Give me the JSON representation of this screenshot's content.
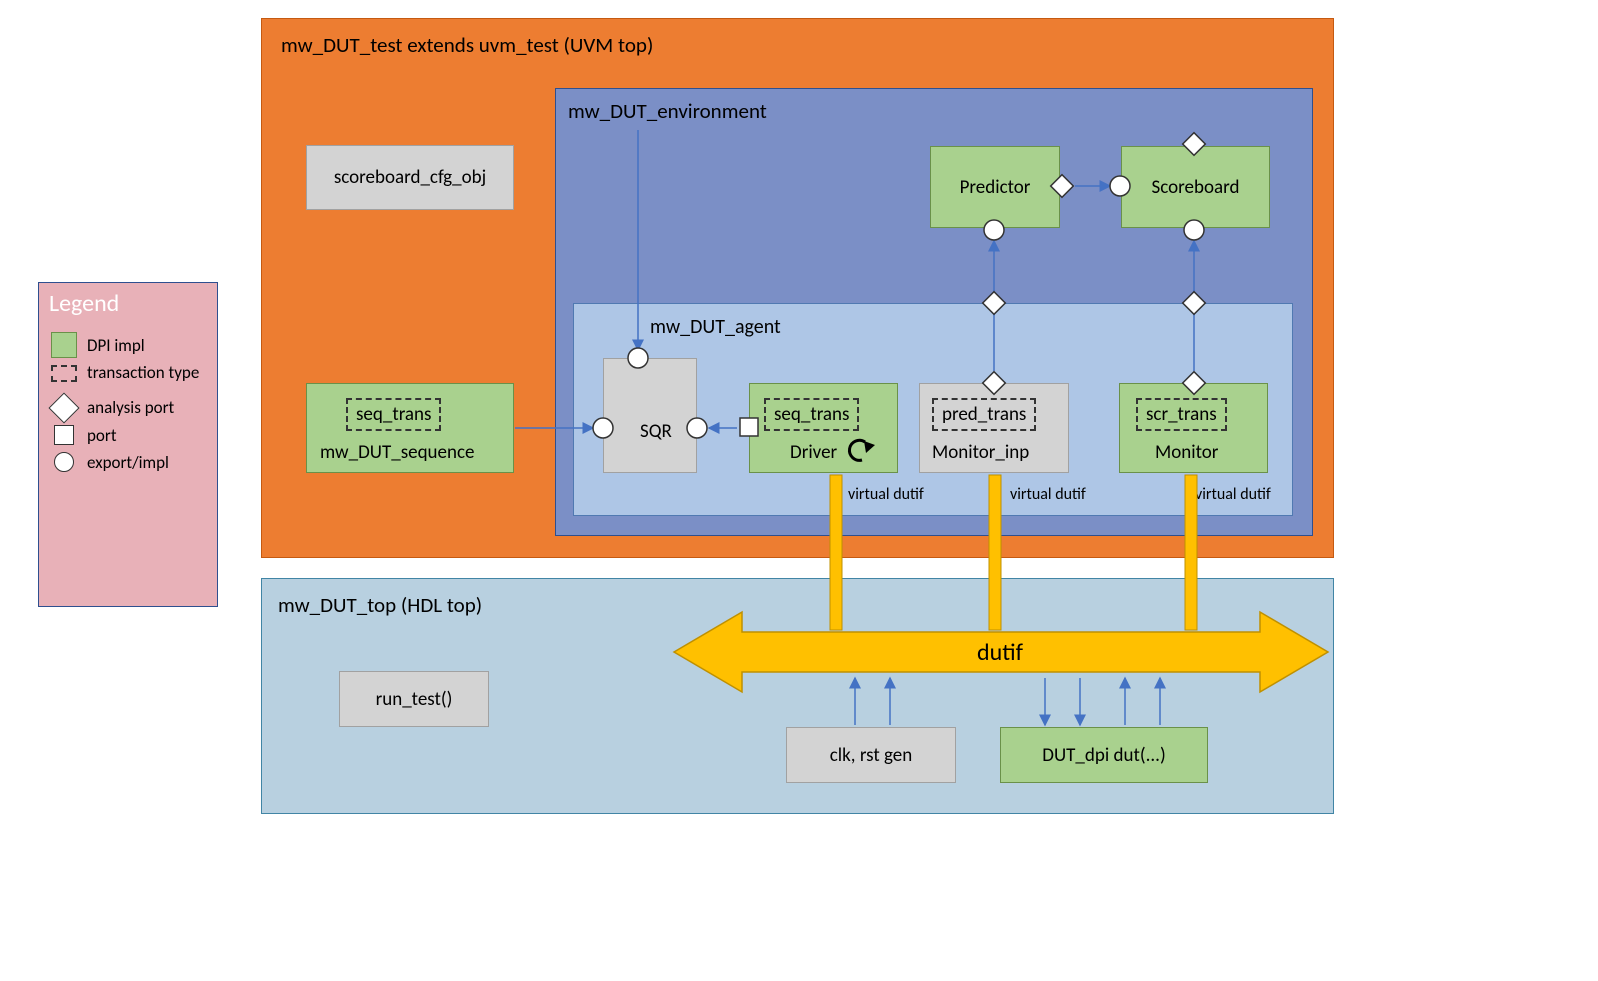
{
  "legend": {
    "title": "Legend",
    "dpi": "DPI impl",
    "trans_type": "transaction type",
    "analysis_port": "analysis port",
    "port": "port",
    "export_impl": "export/impl"
  },
  "uvm_top": {
    "title": "mw_DUT_test extends uvm_test (UVM top)",
    "scoreboard_cfg": "scoreboard_cfg_obj",
    "sequence": {
      "trans": "seq_trans",
      "label": "mw_DUT_sequence"
    },
    "env": {
      "title": "mw_DUT_environment",
      "predictor": "Predictor",
      "scoreboard": "Scoreboard",
      "agent": {
        "title": "mw_DUT_agent",
        "sqr": "SQR",
        "driver": {
          "trans": "seq_trans",
          "label": "Driver"
        },
        "monitor_inp": {
          "trans": "pred_trans",
          "label": "Monitor_inp"
        },
        "monitor": {
          "trans": "scr_trans",
          "label": "Monitor"
        },
        "vdif": "virtual dutif"
      }
    }
  },
  "hdl_top": {
    "title": "mw_DUT_top  (HDL top)",
    "run_test": "run_test()",
    "dutif": "dutif",
    "clk_rst": "clk, rst gen",
    "dut_dpi": "DUT_dpi dut(...)"
  }
}
